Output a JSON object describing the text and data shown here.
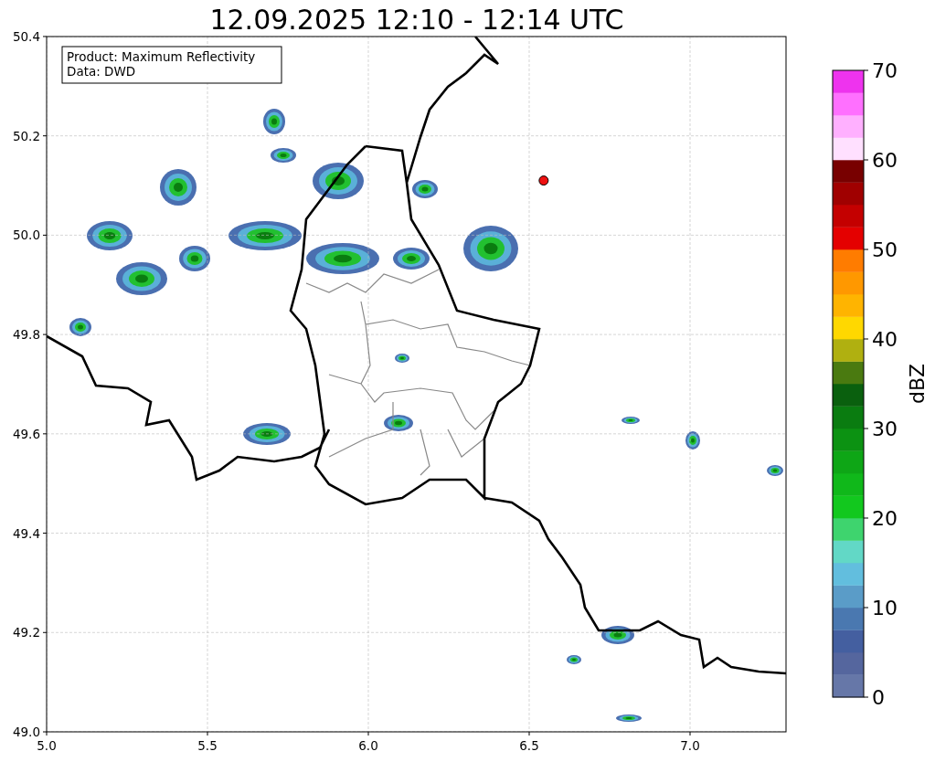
{
  "title": "12.09.2025 12:10 - 12:14 UTC",
  "info_box": [
    "Product: Maximum Reflectivity",
    "Data: DWD"
  ],
  "x_axis": {
    "ticks": [
      "5.0",
      "5.5",
      "6.0",
      "6.5",
      "7.0"
    ]
  },
  "y_axis": {
    "ticks": [
      "50.4",
      "50.2",
      "50.0",
      "49.8",
      "49.6",
      "49.4",
      "49.2",
      "49.0"
    ]
  },
  "colorbar": {
    "label": "dBZ",
    "ticks": [
      "70",
      "60",
      "50",
      "40",
      "30",
      "20",
      "10",
      "0"
    ],
    "bands": [
      {
        "color": "#6677a8"
      },
      {
        "color": "#55669e"
      },
      {
        "color": "#445fa0"
      },
      {
        "color": "#4a78b0"
      },
      {
        "color": "#5a9cc8"
      },
      {
        "color": "#62bede"
      },
      {
        "color": "#62d8c6"
      },
      {
        "color": "#3ed46e"
      },
      {
        "color": "#12c81e"
      },
      {
        "color": "#10b81a"
      },
      {
        "color": "#0ea616"
      },
      {
        "color": "#0c9212"
      },
      {
        "color": "#0a7c10"
      },
      {
        "color": "#0a600e"
      },
      {
        "color": "#4a7a10"
      },
      {
        "color": "#b0b010"
      },
      {
        "color": "#ffd800"
      },
      {
        "color": "#ffb400"
      },
      {
        "color": "#ff9800"
      },
      {
        "color": "#ff7c00"
      },
      {
        "color": "#e40000"
      },
      {
        "color": "#c40000"
      },
      {
        "color": "#a00000"
      },
      {
        "color": "#780000"
      },
      {
        "color": "#ffe0ff"
      },
      {
        "color": "#ffb0ff"
      },
      {
        "color": "#ff70ff"
      },
      {
        "color": "#ee33ee"
      }
    ]
  },
  "marker": {
    "color": "#ee1111"
  }
}
